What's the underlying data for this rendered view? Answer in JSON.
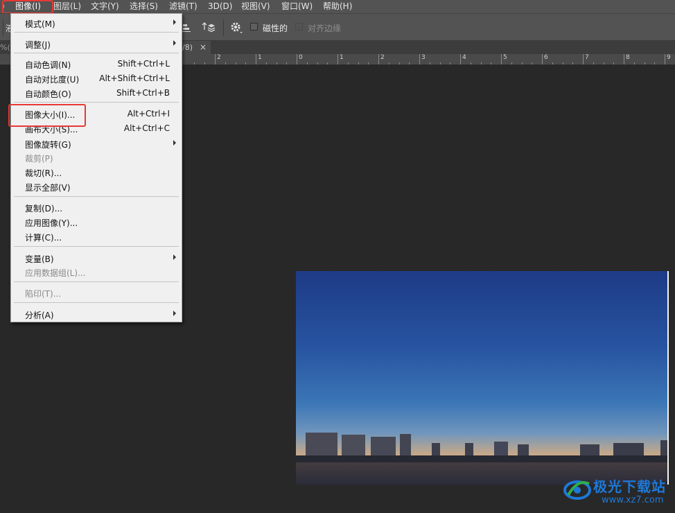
{
  "menubar": {
    "items": [
      {
        "label": ")"
      },
      {
        "label": "图像(I)"
      },
      {
        "label": "图层(L)"
      },
      {
        "label": "文字(Y)"
      },
      {
        "label": "选择(S)"
      },
      {
        "label": "滤镜(T)"
      },
      {
        "label": "3D(D)"
      },
      {
        "label": "视图(V)"
      },
      {
        "label": "窗口(W)"
      },
      {
        "label": "帮助(H)"
      }
    ]
  },
  "options_bar": {
    "left_fragment": "液",
    "magnetic_label": "磁性的",
    "align_edges_label": "对齐边缘"
  },
  "tabs": {
    "left_fragment": "%(R",
    "doc_fragment": "/8)",
    "close": "×"
  },
  "ruler": {
    "labels": [
      "2",
      "1",
      "0",
      "1",
      "2",
      "3",
      "4",
      "5",
      "6",
      "7",
      "8",
      "9"
    ]
  },
  "image_menu": {
    "items": [
      {
        "label": "模式(M)",
        "shortcut": "",
        "submenu": true,
        "disabled": false
      },
      {
        "label": "调整(J)",
        "shortcut": "",
        "submenu": true,
        "disabled": false
      },
      {
        "label": "自动色调(N)",
        "shortcut": "Shift+Ctrl+L",
        "submenu": false,
        "disabled": false
      },
      {
        "label": "自动对比度(U)",
        "shortcut": "Alt+Shift+Ctrl+L",
        "submenu": false,
        "disabled": false
      },
      {
        "label": "自动颜色(O)",
        "shortcut": "Shift+Ctrl+B",
        "submenu": false,
        "disabled": false
      },
      {
        "label": "图像大小(I)...",
        "shortcut": "Alt+Ctrl+I",
        "submenu": false,
        "disabled": false
      },
      {
        "label": "画布大小(S)...",
        "shortcut": "Alt+Ctrl+C",
        "submenu": false,
        "disabled": false
      },
      {
        "label": "图像旋转(G)",
        "shortcut": "",
        "submenu": true,
        "disabled": false
      },
      {
        "label": "裁剪(P)",
        "shortcut": "",
        "submenu": false,
        "disabled": true
      },
      {
        "label": "裁切(R)...",
        "shortcut": "",
        "submenu": false,
        "disabled": false
      },
      {
        "label": "显示全部(V)",
        "shortcut": "",
        "submenu": false,
        "disabled": false
      },
      {
        "label": "复制(D)...",
        "shortcut": "",
        "submenu": false,
        "disabled": false
      },
      {
        "label": "应用图像(Y)...",
        "shortcut": "",
        "submenu": false,
        "disabled": false
      },
      {
        "label": "计算(C)...",
        "shortcut": "",
        "submenu": false,
        "disabled": false
      },
      {
        "label": "变量(B)",
        "shortcut": "",
        "submenu": true,
        "disabled": false
      },
      {
        "label": "应用数据组(L)...",
        "shortcut": "",
        "submenu": false,
        "disabled": true
      },
      {
        "label": "陷印(T)...",
        "shortcut": "",
        "submenu": false,
        "disabled": true
      },
      {
        "label": "分析(A)",
        "shortcut": "",
        "submenu": true,
        "disabled": false
      }
    ]
  },
  "highlight_color": "#e53935",
  "watermark": {
    "title": "极光下载站",
    "url": "www.xz7.com"
  }
}
